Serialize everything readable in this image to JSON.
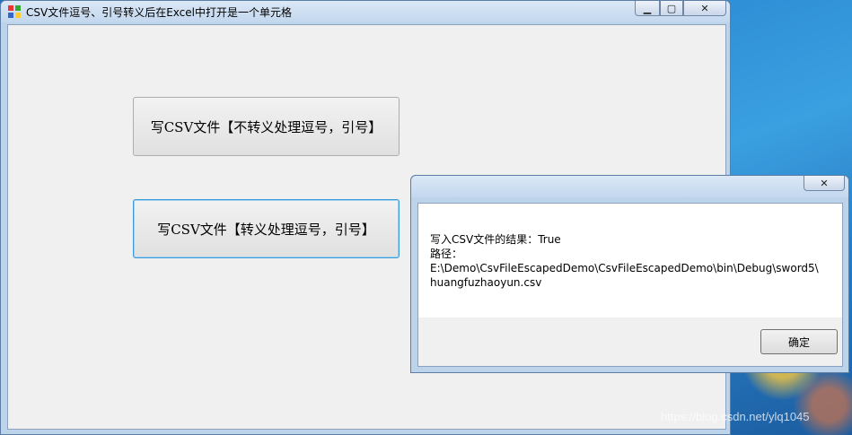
{
  "window": {
    "title": "CSV文件逗号、引号转义后在Excel中打开是一个单元格",
    "controls": {
      "minimize": "▁",
      "maximize": "▢",
      "close": "✕"
    }
  },
  "buttons": {
    "write_no_escape": "写CSV文件【不转义处理逗号，引号】",
    "write_escape": "写CSV文件【转义处理逗号，引号】"
  },
  "message_box": {
    "close": "✕",
    "lines": [
      "写入CSV文件的结果：True",
      "路径：",
      "E:\\Demo\\CsvFileEscapedDemo\\CsvFileEscapedDemo\\bin\\Debug\\sword5\\",
      "huangfuzhaoyun.csv"
    ],
    "ok_label": "确定"
  },
  "watermark": "https://blog.csdn.net/ylq1045"
}
